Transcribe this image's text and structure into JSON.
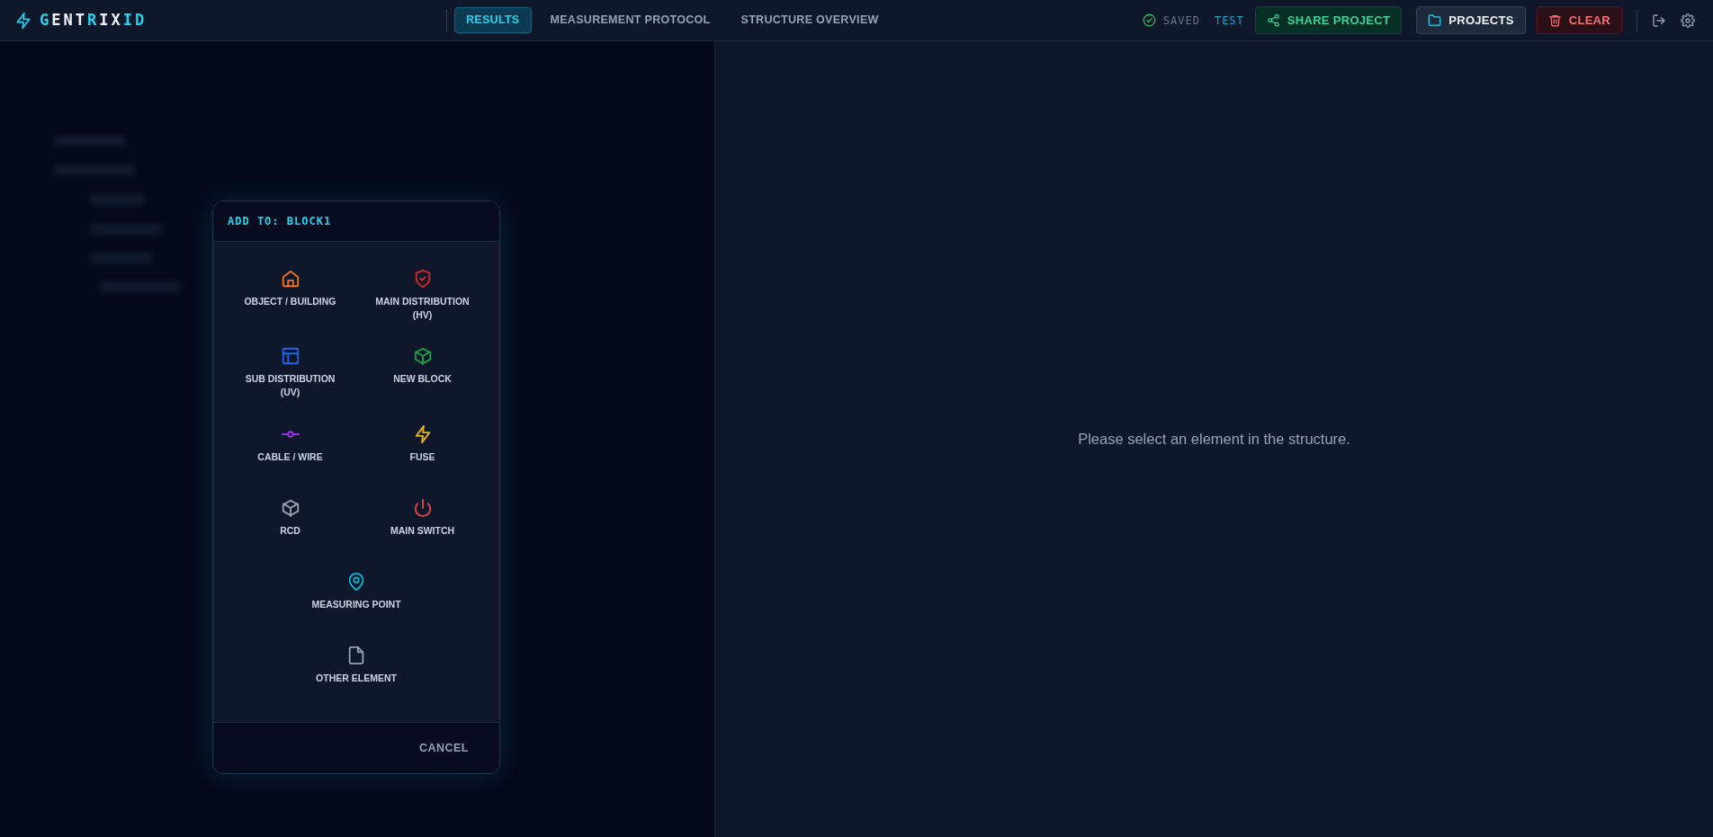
{
  "logo": {
    "letters": [
      {
        "text": "G",
        "accent": true
      },
      {
        "text": "ENT",
        "accent": false
      },
      {
        "text": "R",
        "accent": true
      },
      {
        "text": "IX",
        "accent": false
      },
      {
        "text": "ID",
        "accent": true
      }
    ]
  },
  "tabs": [
    {
      "label": "RESULTS",
      "selected": true
    },
    {
      "label": "MEASUREMENT PROTOCOL",
      "selected": false
    },
    {
      "label": "STRUCTURE OVERVIEW",
      "selected": false
    }
  ],
  "status": {
    "saved": "SAVED",
    "project": "TEST"
  },
  "buttons": [
    {
      "kind": "share",
      "label": "SHARE PROJECT"
    },
    {
      "kind": "projects",
      "label": "PROJECTS"
    },
    {
      "kind": "clear",
      "label": "CLEAR"
    }
  ],
  "dialog": {
    "title": "ADD TO: BLOCK1",
    "grid_items": [
      {
        "kind": "house",
        "label": "OBJECT / BUILDING",
        "color": "#f97316"
      },
      {
        "kind": "shield",
        "label": "MAIN DISTRIBUTION (HV)",
        "color": "#dc2626"
      },
      {
        "kind": "panel",
        "label": "SUB DISTRIBUTION (UV)",
        "color": "#2563eb"
      },
      {
        "kind": "cube",
        "label": "NEW BLOCK",
        "color": "#16a34a"
      },
      {
        "kind": "wire",
        "label": "CABLE / WIRE",
        "color": "#9333ea"
      },
      {
        "kind": "bolt",
        "label": "FUSE",
        "color": "#eab308"
      },
      {
        "kind": "cube",
        "label": "RCD",
        "color": "#9ca3af"
      },
      {
        "kind": "power",
        "label": "MAIN SWITCH",
        "color": "#ef4444"
      }
    ],
    "single_items": [
      {
        "kind": "pin",
        "label": "MEASURING POINT",
        "color": "#06b6d4"
      },
      {
        "kind": "file",
        "label": "OTHER ELEMENT",
        "color": "#94a3b8"
      }
    ],
    "cancel": "CANCEL"
  },
  "detail": {
    "message": "Please select an element in the structure."
  }
}
